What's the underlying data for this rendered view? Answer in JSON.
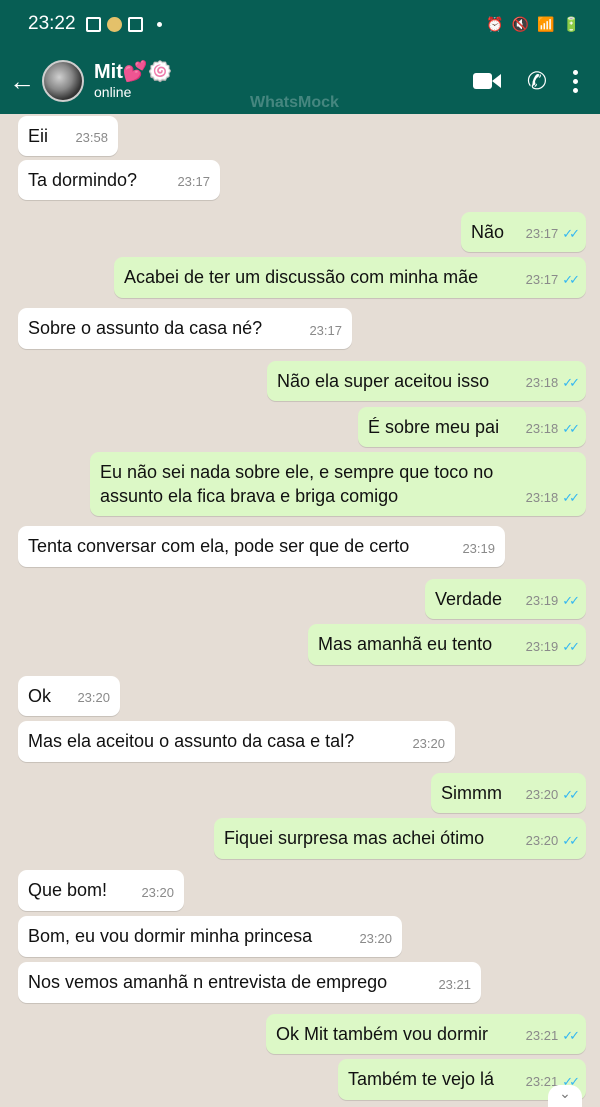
{
  "status_bar": {
    "time": "23:22"
  },
  "header": {
    "back_icon": "arrow-left-icon",
    "name": "Mit💕🍥",
    "status": "online",
    "watermark": "WhatsMock"
  },
  "messages": [
    {
      "dir": "in",
      "text": "Eii",
      "time": "23:58"
    },
    {
      "dir": "in",
      "text": "Ta dormindo?",
      "time": "23:17"
    },
    {
      "dir": "out",
      "text": "Não",
      "time": "23:17",
      "read": true
    },
    {
      "dir": "out",
      "text": "Acabei de ter um discussão com minha mãe",
      "time": "23:17",
      "read": true
    },
    {
      "dir": "in",
      "text": "Sobre o assunto da casa né?",
      "time": "23:17"
    },
    {
      "dir": "out",
      "text": "Não ela super aceitou isso",
      "time": "23:18",
      "read": true
    },
    {
      "dir": "out",
      "text": "É sobre meu pai",
      "time": "23:18",
      "read": true
    },
    {
      "dir": "out",
      "text": "Eu não sei nada sobre ele, e sempre que toco no assunto ela fica brava e briga comigo",
      "time": "23:18",
      "read": true
    },
    {
      "dir": "in",
      "text": "Tenta conversar com ela, pode ser que de certo",
      "time": "23:19"
    },
    {
      "dir": "out",
      "text": "Verdade",
      "time": "23:19",
      "read": true
    },
    {
      "dir": "out",
      "text": "Mas amanhã eu tento",
      "time": "23:19",
      "read": true
    },
    {
      "dir": "in",
      "text": "Ok",
      "time": "23:20"
    },
    {
      "dir": "in",
      "text": "Mas ela aceitou o assunto da casa e tal?",
      "time": "23:20"
    },
    {
      "dir": "out",
      "text": "Simmm",
      "time": "23:20",
      "read": true
    },
    {
      "dir": "out",
      "text": "Fiquei surpresa mas achei ótimo",
      "time": "23:20",
      "read": true
    },
    {
      "dir": "in",
      "text": "Que bom!",
      "time": "23:20"
    },
    {
      "dir": "in",
      "text": "Bom, eu vou dormir minha princesa",
      "time": "23:20"
    },
    {
      "dir": "in",
      "text": "Nos vemos amanhã n entrevista de emprego",
      "time": "23:21"
    },
    {
      "dir": "out",
      "text": "Ok Mit também vou dormir",
      "time": "23:21",
      "read": true
    },
    {
      "dir": "out",
      "text": "Também te vejo lá",
      "time": "23:21",
      "read": true
    }
  ],
  "colors": {
    "header": "#075e54",
    "outgoing": "#dcf8c6",
    "incoming": "#ffffff",
    "chat_bg": "#e5ddd5",
    "read_ticks": "#34b7f1"
  }
}
